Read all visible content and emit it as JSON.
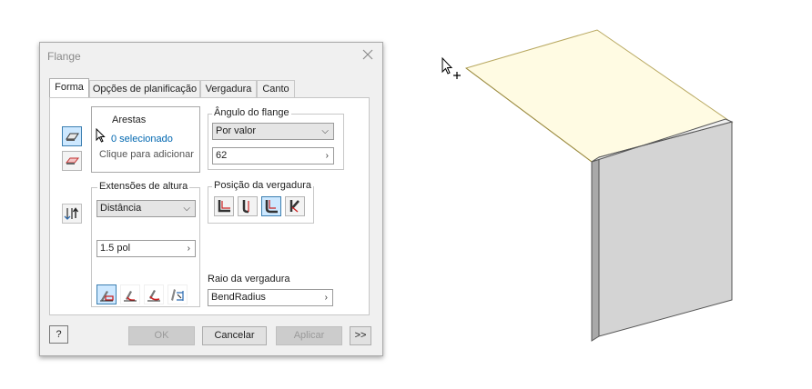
{
  "dialog": {
    "title": "Flange",
    "tabs": [
      "Forma",
      "Opções de planificação",
      "Vergadura",
      "Canto"
    ],
    "edges": {
      "label": "Arestas",
      "selected": "0 selecionado",
      "hint": "Clique para adicionar"
    },
    "flange_angle": {
      "label": "Ângulo do flange",
      "mode": "Por valor",
      "value": "62"
    },
    "height_extents": {
      "label": "Extensões de altura",
      "mode": "Distância",
      "value": "1.5 pol"
    },
    "bend_position": {
      "label": "Posição da vergadura"
    },
    "bend_radius": {
      "label": "Raio da vergadura",
      "value": "BendRadius"
    },
    "buttons": {
      "help": "?",
      "ok": "OK",
      "cancel": "Cancelar",
      "apply": "Aplicar",
      "more": ">>"
    }
  },
  "colors": {
    "accent_blue": "#0067b0",
    "selected_button": "#cde8ff",
    "face_highlight": "#fffbe3",
    "edge_highlight": "#b8a860",
    "part_gray": "#d4d4d4"
  }
}
